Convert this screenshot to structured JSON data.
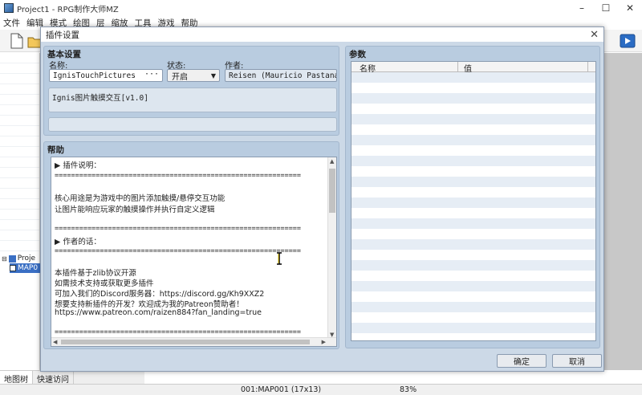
{
  "window": {
    "title": "Project1 - RPG制作大师MZ",
    "minimize_icon": "minimize-icon",
    "maximize_icon": "maximize-icon",
    "close_icon": "close-icon"
  },
  "menu": [
    "文件",
    "编辑",
    "模式",
    "绘图",
    "层",
    "缩放",
    "工具",
    "游戏",
    "帮助"
  ],
  "tree": {
    "root": "Proje",
    "map": "MAP0"
  },
  "left_tabs": [
    "地图树",
    "快速访问"
  ],
  "status": {
    "map": "001:MAP001 (17x13)",
    "zoom": "83%"
  },
  "dialog": {
    "title": "插件设置",
    "basic": {
      "title": "基本设置",
      "name_label": "名称:",
      "name_value": "IgnisTouchPictures",
      "name_button": "···",
      "status_label": "状态:",
      "status_value": "开启",
      "author_label": "作者:",
      "author_value": "Reisen (Mauricio Pastana)",
      "description": "Ignis图片触摸交互[v1.0]"
    },
    "help": {
      "title": "帮助",
      "lines": [
        "▶ 插件说明：",
        "============================================================",
        "",
        "核心用途是为游戏中的图片添加触摸/悬停交互功能",
        "让图片能响应玩家的触摸操作并执行自定义逻辑",
        "",
        "============================================================",
        "▶ 作者的话：",
        "============================================================",
        "",
        "本插件基于zlib协议开源",
        "如需技术支持或获取更多插件",
        "可加入我们的Discord服务器：https://discord.gg/Kh9XXZ2",
        "想要支持新插件的开发？欢迎成为我的Patreon赞助者！",
        "https://www.patreon.com/raizen884?fan_landing=true",
        "",
        "============================================================"
      ]
    },
    "params": {
      "title": "参数",
      "col_name": "名称",
      "col_value": "值"
    },
    "ok_label": "确定",
    "cancel_label": "取消"
  }
}
